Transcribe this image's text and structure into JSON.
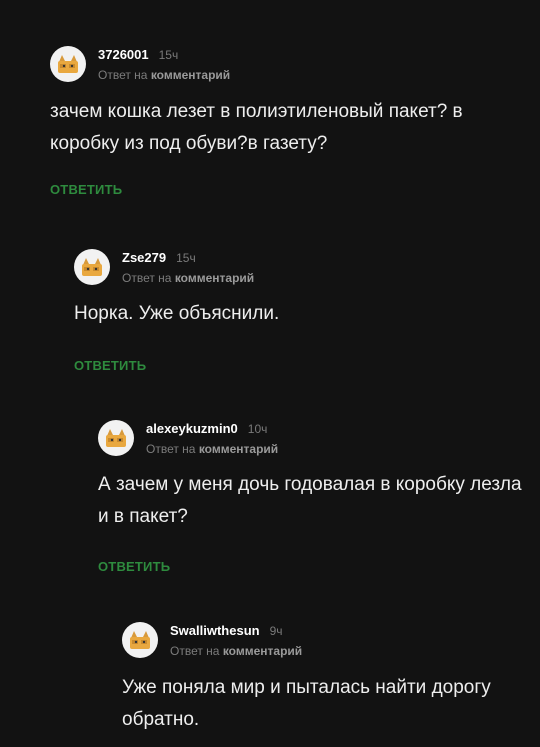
{
  "comments": [
    {
      "username": "3726001",
      "time": "15ч",
      "reply_prefix": "Ответ на",
      "reply_target": "комментарий",
      "text": "зачем кошка лезет в полиэтиленовый пакет? в коробку из под обуви?в газету?",
      "reply_label": "ОТВЕТИТЬ",
      "avatar_icon": "cat-avatar-icon"
    },
    {
      "username": "Zse279",
      "time": "15ч",
      "reply_prefix": "Ответ на",
      "reply_target": "комментарий",
      "text": "Норка. Уже объяснили.",
      "reply_label": "ОТВЕТИТЬ",
      "avatar_icon": "cat-avatar-icon"
    },
    {
      "username": "alexeykuzmin0",
      "time": "10ч",
      "reply_prefix": "Ответ на",
      "reply_target": "комментарий",
      "text": "А зачем у меня дочь годовалая в коробку лезла и в пакет?",
      "reply_label": "ОТВЕТИТЬ",
      "avatar_icon": "cat-avatar-icon"
    },
    {
      "username": "Swalliwthesun",
      "time": "9ч",
      "reply_prefix": "Ответ на",
      "reply_target": "комментарий",
      "text": "Уже поняла мир и пыталась найти дорогу обратно.",
      "avatar_icon": "cat-avatar-icon"
    }
  ],
  "colors": {
    "background": "#121212",
    "text": "#eeeeee",
    "muted": "#7a7a7a",
    "accent": "#2e8b3e"
  }
}
